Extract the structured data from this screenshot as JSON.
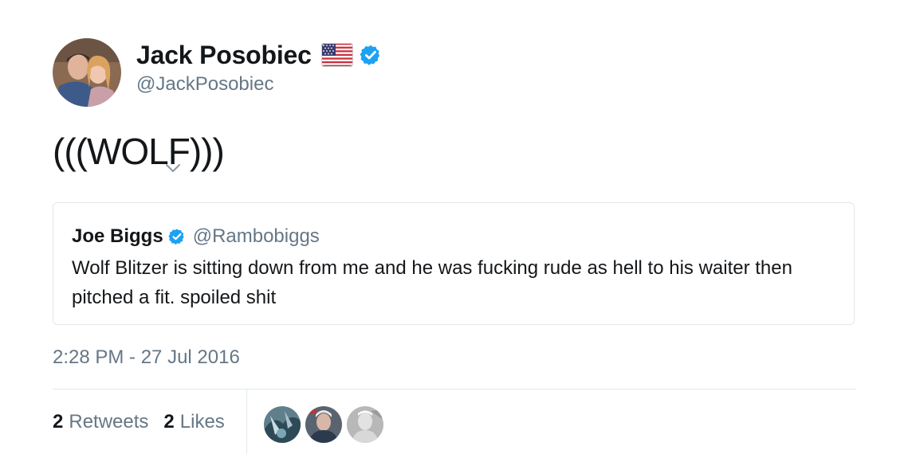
{
  "author": {
    "display_name": "Jack Posobiec",
    "handle": "@JackPosobiec",
    "flag": "us-flag-icon",
    "verified": true
  },
  "tweet": {
    "text": "(((WOLF)))",
    "timestamp": "2:28 PM - 27 Jul 2016"
  },
  "quoted_tweet": {
    "display_name": "Joe Biggs",
    "handle": "@Rambobiggs",
    "verified": true,
    "text": "Wolf Blitzer is sitting down from me and he was fucking rude as hell to his waiter then pitched a fit. spoiled shit"
  },
  "stats": {
    "retweets_count": "2",
    "retweets_label": "Retweets",
    "likes_count": "2",
    "likes_label": "Likes"
  },
  "colors": {
    "text": "#14171a",
    "secondary": "#657786",
    "verified": "#1da1f2",
    "border": "#e1e8ed"
  }
}
